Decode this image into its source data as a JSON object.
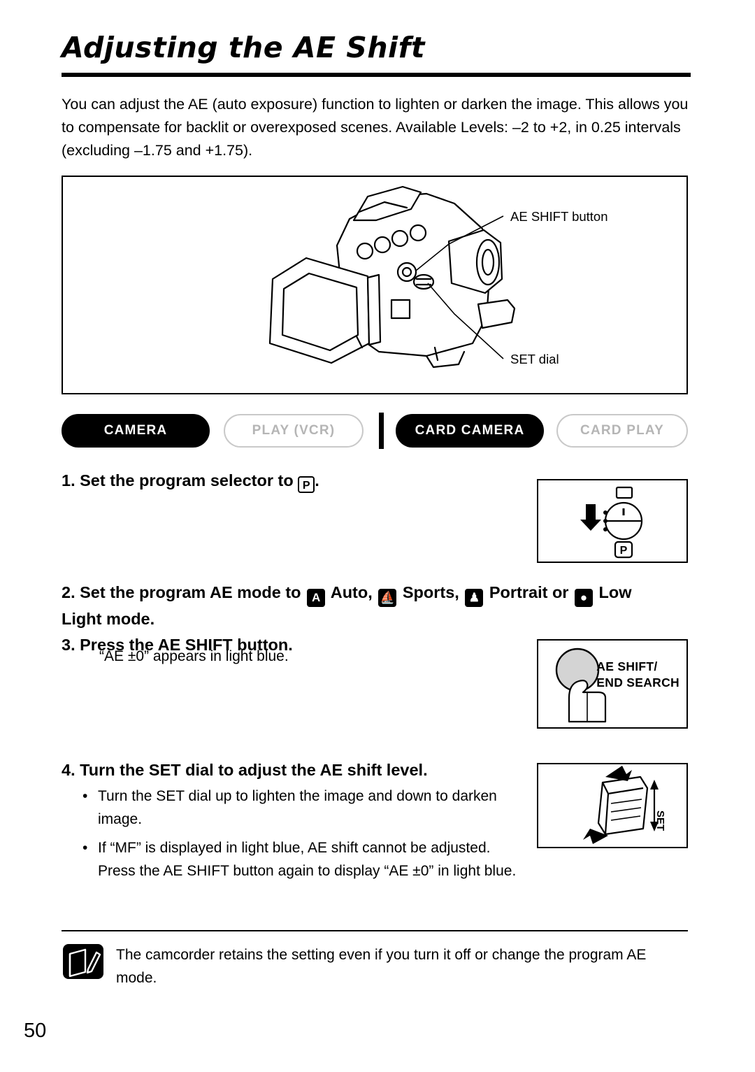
{
  "page": {
    "title": "Adjusting the AE Shift",
    "number": "50"
  },
  "intro": "You can adjust the AE (auto exposure) function to lighten or darken the image. This allows you to compensate for backlit or overexposed scenes. Available Levels: –2 to +2, in 0.25 intervals (excluding –1.75 and +1.75).",
  "figure": {
    "callout_top": "AE SHIFT button",
    "callout_bottom": "SET dial",
    "alt": "camcorder-illustration"
  },
  "modes": [
    {
      "label": "CAMERA",
      "state": "on"
    },
    {
      "label": "PLAY (VCR)",
      "state": "off"
    },
    {
      "label": "CARD CAMERA",
      "state": "on"
    },
    {
      "label": "CARD PLAY",
      "state": "off"
    }
  ],
  "steps": {
    "step1_prefix": "1. Set the program selector to ",
    "step1_icon": "P",
    "step1_suffix": ".",
    "step2_a": "2. Set the program AE mode to ",
    "step2_auto_icon": "A",
    "step2_b": " Auto, ",
    "step2_sports_icon": "sports-icon",
    "step2_c": " Sports, ",
    "step2_portrait_icon": "portrait-icon",
    "step2_d": " Portrait or ",
    "step2_lowlight_icon": "lowlight-icon",
    "step2_e": " Low",
    "step2_line2": "Light mode.",
    "step3": "3. Press the AE SHIFT button.",
    "step3_note": "“AE ±0” appears in light blue.",
    "step4": "4. Turn the SET dial to adjust the AE shift level.",
    "bullets": [
      "Turn the SET dial up to lighten the image and down to darken image.",
      "If “MF” is displayed in light blue, AE shift cannot be adjusted. Press the AE SHIFT button again to display “AE ±0” in light blue."
    ]
  },
  "illustrations": {
    "program_selector_icon": "program-selector-dial",
    "ae_shift_button_label_line1": "AE SHIFT/",
    "ae_shift_button_label_line2": "END SEARCH",
    "set_dial_label": "SET"
  },
  "note": {
    "icon": "notes-pencil-icon",
    "text": "The camcorder retains the setting even if you turn it off or change the program AE mode."
  }
}
